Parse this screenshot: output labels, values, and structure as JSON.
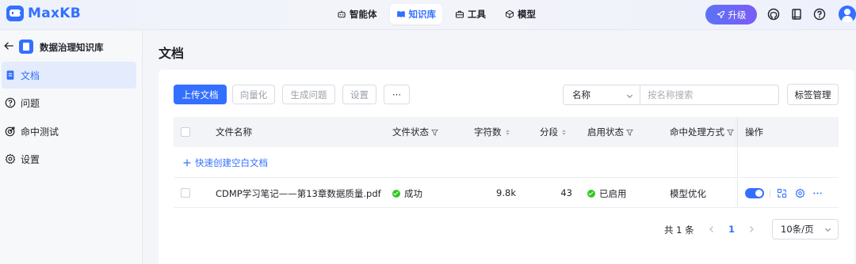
{
  "app": {
    "logo_text": "MaxKB",
    "brand_color": "#3370ff"
  },
  "topnav": {
    "items": [
      {
        "label": "智能体",
        "icon": "robot-icon",
        "active": false
      },
      {
        "label": "知识库",
        "icon": "book-icon",
        "active": true
      },
      {
        "label": "工具",
        "icon": "toolbox-icon",
        "active": false
      },
      {
        "label": "模型",
        "icon": "cube-icon",
        "active": false
      }
    ],
    "upgrade_label": "升级",
    "right_icons": [
      "github-icon",
      "docs-icon",
      "help-icon",
      "user-avatar"
    ]
  },
  "sidebar": {
    "knowledge_base_name": "数据治理知识库",
    "items": [
      {
        "label": "文档",
        "icon": "document-icon",
        "active": true
      },
      {
        "label": "问题",
        "icon": "question-icon",
        "active": false
      },
      {
        "label": "命中测试",
        "icon": "target-icon",
        "active": false
      },
      {
        "label": "设置",
        "icon": "gear-icon",
        "active": false
      }
    ]
  },
  "main": {
    "title": "文档",
    "toolbar": {
      "upload_label": "上传文档",
      "vectorize_label": "向量化",
      "generate_questions_label": "生成问题",
      "settings_label": "设置",
      "more_label": "···",
      "filter_select_value": "名称",
      "search_placeholder": "按名称搜索",
      "tag_manage_label": "标签管理"
    },
    "table": {
      "columns": [
        "文件名称",
        "文件状态",
        "字符数",
        "分段",
        "启用状态",
        "命中处理方式",
        "操作"
      ],
      "quick_create_label": "快速创建空白文档",
      "rows": [
        {
          "name": "CDMP学习笔记——第13章数据质量.pdf",
          "status": "成功",
          "char_count": "9.8k",
          "segments": "43",
          "enabled_status": "已启用",
          "hit_handling": "模型优化",
          "enabled": true
        }
      ]
    },
    "pagination": {
      "total_label": "共 1 条",
      "current_page": "1",
      "page_size": "10条/页"
    }
  }
}
